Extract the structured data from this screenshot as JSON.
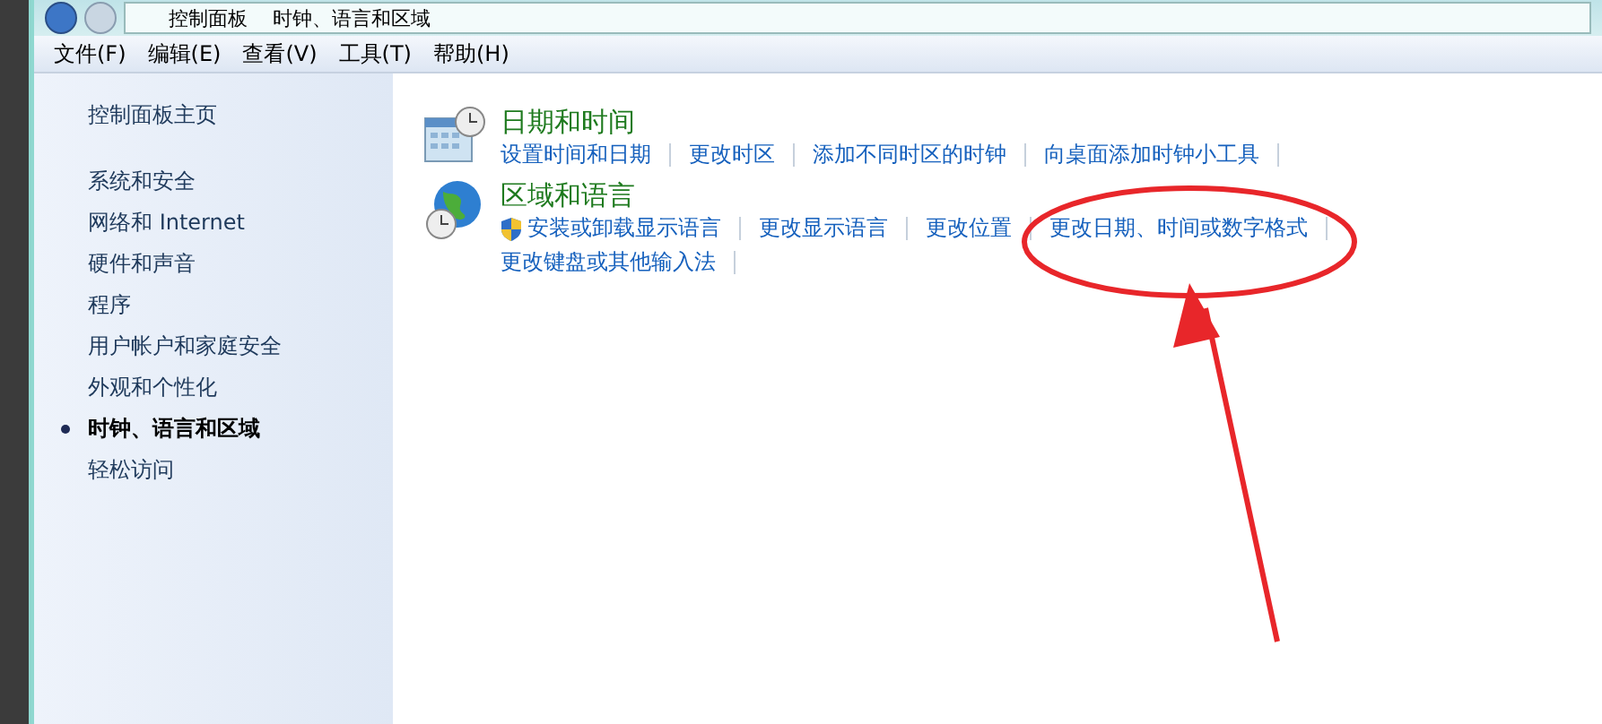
{
  "address_bar": {
    "breadcrumbs": [
      "控制面板",
      "时钟、语言和区域"
    ]
  },
  "menu_bar": [
    "文件(F)",
    "编辑(E)",
    "查看(V)",
    "工具(T)",
    "帮助(H)"
  ],
  "sidebar": {
    "home": "控制面板主页",
    "items": [
      {
        "label": "系统和安全",
        "selected": false
      },
      {
        "label": "网络和 Internet",
        "selected": false
      },
      {
        "label": "硬件和声音",
        "selected": false
      },
      {
        "label": "程序",
        "selected": false
      },
      {
        "label": "用户帐户和家庭安全",
        "selected": false
      },
      {
        "label": "外观和个性化",
        "selected": false
      },
      {
        "label": "时钟、语言和区域",
        "selected": true
      },
      {
        "label": "轻松访问",
        "selected": false
      }
    ]
  },
  "categories": [
    {
      "kind": "clock",
      "title": "日期和时间",
      "links": [
        {
          "label": "设置时间和日期",
          "shield": false
        },
        {
          "label": "更改时区",
          "shield": false
        },
        {
          "label": "添加不同时区的时钟",
          "shield": false
        },
        {
          "label": "向桌面添加时钟小工具",
          "shield": false
        }
      ]
    },
    {
      "kind": "globe",
      "title": "区域和语言",
      "links": [
        {
          "label": "安装或卸载显示语言",
          "shield": true
        },
        {
          "label": "更改显示语言",
          "shield": false
        },
        {
          "label": "更改位置",
          "shield": false
        },
        {
          "label": "更改日期、时间或数字格式",
          "shield": false
        },
        {
          "label": "更改键盘或其他输入法",
          "shield": false
        }
      ]
    }
  ]
}
